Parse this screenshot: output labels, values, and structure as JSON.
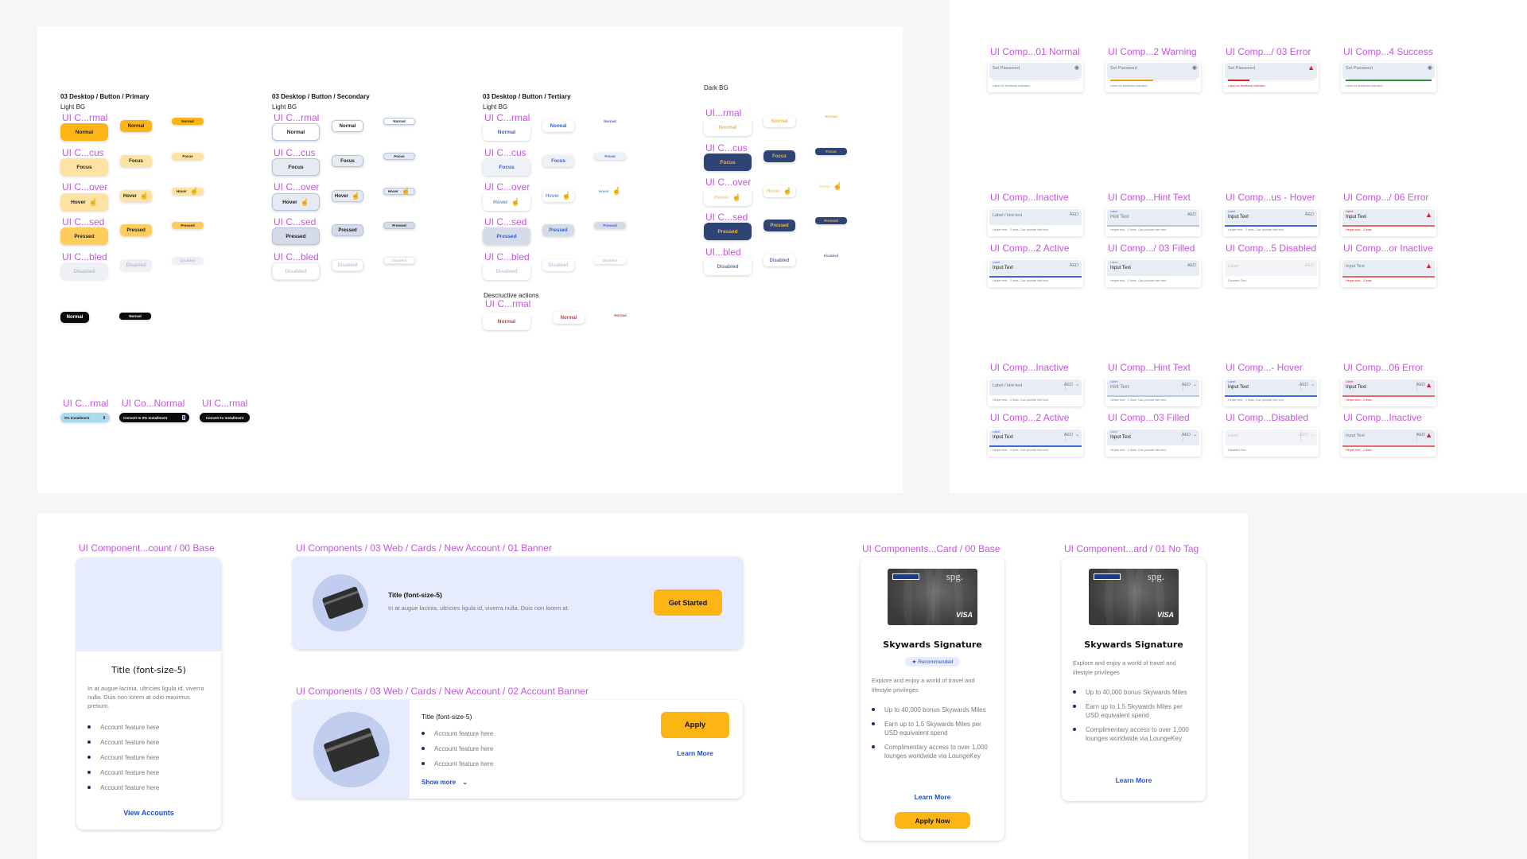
{
  "buttons_frame": {
    "primary": {
      "title": "03 Desktop / Button / Primary",
      "bg_label": "Light BG",
      "layer_labels": [
        "UI C...rmal",
        "UI C...cus",
        "UI C...over",
        "UI C...sed",
        "UI C...bled"
      ],
      "states": [
        "Normal",
        "Focus",
        "Hover",
        "Pressed",
        "Disabled"
      ],
      "black_states": [
        "Normal",
        "Normal"
      ],
      "accent_color": "#fdb515"
    },
    "secondary": {
      "title": "03 Desktop / Button / Secondary",
      "bg_label": "Light BG",
      "layer_labels": [
        "UI C...rmal",
        "UI C...cus",
        "UI C...over",
        "UI C...sed",
        "UI C...bled"
      ],
      "states": [
        "Normal",
        "Focus",
        "Hover",
        "Pressed",
        "Disabled"
      ]
    },
    "tertiary": {
      "title": "03 Desktop / Button / Tertiary",
      "bg_label": "Light BG",
      "layer_labels": [
        "UI C...rmal",
        "UI C...cus",
        "UI C...over",
        "UI C...sed",
        "UI C...bled"
      ],
      "states": [
        "Normal",
        "Focus",
        "Hover",
        "Pressed",
        "Disabled"
      ],
      "destructive_title": "Descructive actions",
      "destructive_layer_label": "UI C...rmal",
      "destructive_states": [
        "Normal",
        "Normal",
        "Normal"
      ]
    },
    "dark": {
      "bg_label": "Dark BG",
      "layer_labels": [
        "UI...rmal",
        "UI C...cus",
        "UI C...over",
        "UI C...sed",
        "UI...bled"
      ],
      "states": [
        "Normal",
        "Focus",
        "Hover",
        "Pressed",
        "Disabled"
      ],
      "navy": "#2e4475"
    },
    "installment": {
      "layer_labels": [
        "UI C...rmal",
        "UI Co...Normal",
        "UI C...rmal"
      ],
      "labels": [
        "0% Installment",
        "Convert to 0% Installment",
        "Convert to Installment"
      ]
    }
  },
  "fields_frame": {
    "password": [
      {
        "layer": "UI Comp...01 Normal",
        "placeholder": "Set Password",
        "feedback": "Label for feedback indicator.",
        "state": "normal",
        "icon": "eye-icon"
      },
      {
        "layer": "UI Comp...2 Warning",
        "placeholder": "Set Password",
        "feedback": "Label for feedback indicator.",
        "state": "warning",
        "icon": "eye-icon",
        "strength": 0.5
      },
      {
        "layer": "UI Comp.../ 03 Error",
        "placeholder": "Set Password",
        "feedback": "Label for feedback indicator.",
        "state": "error",
        "icon": "warning-icon",
        "strength": 0.25
      },
      {
        "layer": "UI Comp...4 Success",
        "placeholder": "Set Password",
        "feedback": "Label for feedback indicator.",
        "state": "success",
        "icon": "eye-icon",
        "strength": 1.0
      }
    ],
    "amount_inputs": [
      {
        "layer": "UI Comp...Inactive",
        "label": "",
        "value": "Label / hint text",
        "suffix": "AED",
        "helper": "Helper text - 2 lines. Can provide hint text.",
        "state": "inactive"
      },
      {
        "layer": "UI Comp...Hint Text",
        "label": "Label",
        "value": "Hint Text",
        "suffix": "AED",
        "helper": "Helper text - 2 lines. Can provide hint text.",
        "state": "hint"
      },
      {
        "layer": "UI Comp...us - Hover",
        "label": "Label",
        "value": "Input Text",
        "suffix": "AED",
        "helper": "Helper text - 2 lines. Can provide hint text.",
        "state": "hover"
      },
      {
        "layer": "UI Comp.../ 06 Error",
        "label": "Label",
        "value": "Input Text",
        "suffix": "",
        "helper": "Helper text - 2 lines",
        "state": "error"
      },
      {
        "layer": "UI Comp...2 Active",
        "label": "Label",
        "value": "Input Text",
        "suffix": "AED",
        "helper": "Helper text - 2 lines. Can provide hint text.",
        "state": "active"
      },
      {
        "layer": "UI Comp.../ 03 Filled",
        "label": "Label",
        "value": "Input Text",
        "suffix": "AED",
        "helper": "Helper text - 2 lines. Can provide hint text.",
        "state": "filled"
      },
      {
        "layer": "UI Comp...5 Disabled",
        "label": "",
        "value": "Label",
        "suffix": "AED",
        "helper": "Disabled Text.",
        "state": "disabled"
      },
      {
        "layer": "UI Comp...or Inactive",
        "label": "",
        "value": "Input Text",
        "suffix": "",
        "helper": "Helper text - 2 lines",
        "state": "error-inactive"
      }
    ],
    "dropdown_inputs": [
      {
        "layer": "UI Comp...Inactive",
        "label": "",
        "value": "Label / hint text",
        "suffix": "AED",
        "helper": "Helper text - 2 lines. Can provide hint text.",
        "state": "inactive"
      },
      {
        "layer": "UI Comp...Hint Text",
        "label": "Label",
        "value": "Hint Text",
        "suffix": "AED",
        "helper": "Helper text - 2 lines. Can provide hint text.",
        "state": "hint"
      },
      {
        "layer": "UI Comp...- Hover",
        "label": "Label",
        "value": "Input Text",
        "suffix": "AED",
        "helper": "Helper text - 2 lines. Can provide hint text.",
        "state": "hover"
      },
      {
        "layer": "UI Comp...06 Error",
        "label": "Label",
        "value": "Input Text",
        "suffix": "AED",
        "helper": "Helper text - 2 lines",
        "state": "error"
      },
      {
        "layer": "UI Comp...2 Active",
        "label": "Label",
        "value": "Input Text",
        "suffix": "AED",
        "helper": "Helper text - 2 lines. Can provide hint text.",
        "state": "active"
      },
      {
        "layer": "UI Comp...03 Filled",
        "label": "Label",
        "value": "Input Text",
        "suffix": "AED",
        "helper": "Helper text - 2 lines. Can provide hint text.",
        "state": "filled"
      },
      {
        "layer": "UI Comp...Disabled",
        "label": "",
        "value": "Label",
        "suffix": "AED",
        "helper": "Disabled Text.",
        "state": "disabled"
      },
      {
        "layer": "UI Comp...Inactive",
        "label": "",
        "value": "Input Text",
        "suffix": "AED",
        "helper": "Helper text - 2 lines",
        "state": "error-inactive"
      }
    ]
  },
  "cards_frame": {
    "account_base": {
      "layer": "UI Component...count / 00 Base",
      "title": "Title (font-size-5)",
      "description": "In at augue lacinia, ultricies ligula id, viverra nulla. Duis non lorem at odio maximus pretium.",
      "features": [
        "Account feature here",
        "Account feature here",
        "Account feature here",
        "Account feature here",
        "Account feature here"
      ],
      "link": "View Accounts"
    },
    "banner": {
      "layer": "UI Components / 03 Web / Cards / New Account / 01 Banner",
      "title": "Title (font-size-5)",
      "description": "In at augue lacinia, ultricies ligula id, viverra nulla. Duis non lorem at.",
      "cta": "Get Started"
    },
    "account_banner": {
      "layer": "UI Components / 03 Web / Cards / New Account / 02 Account Banner",
      "title": "Title (font-size-5)",
      "features": [
        "Account feature here",
        "Account feature here",
        "Account feature here"
      ],
      "show_more": "Show more",
      "cta": "Apply",
      "link": "Learn More"
    },
    "credit_card_base": {
      "layer": "UI Components...Card / 00 Base",
      "title": "Skywards Signature",
      "tag": "Recommended",
      "description": "Explore and enjoy a world of travel and lifestyle privileges",
      "features": [
        "Up to 40,000 bonus Skywards Miles",
        "Earn up to 1.5 Skywards Miles per USD equivalent spend",
        "Complimentary access to over 1,000 lounges worldwide via LoungeKey"
      ],
      "link": "Learn More",
      "cta": "Apply Now",
      "card_brand": "VISA",
      "card_logo": "spg."
    },
    "credit_card_notag": {
      "layer": "UI Component...ard / 01 No Tag",
      "title": "Skywards Signature",
      "description": "Explore and enjoy a world of travel and lifestyle privileges",
      "features": [
        "Up to 40,000 bonus Skywards Miles",
        "Earn up to 1.5 Skywards Miles per USD equivalent spend",
        "Complimentary access to over 1,000 lounges worldwide via LoungeKey"
      ],
      "link": "Learn More",
      "card_brand": "VISA",
      "card_logo": "spg."
    }
  }
}
